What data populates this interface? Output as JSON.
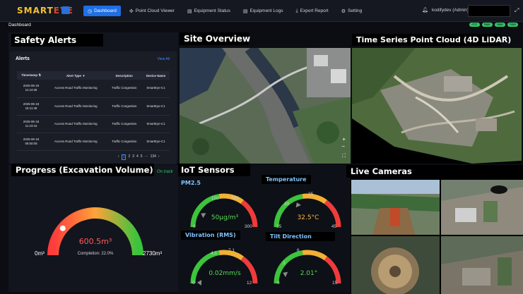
{
  "app": {
    "logo_a": "SMART",
    "logo_b": "EYE"
  },
  "nav": [
    {
      "icon": "◷",
      "label": "Dashboard"
    },
    {
      "icon": "✣",
      "label": "Point Cloud Viewer"
    },
    {
      "icon": "▤",
      "label": "Equipment Status"
    },
    {
      "icon": "▤",
      "label": "Equipment Logs"
    },
    {
      "icon": "⤓",
      "label": "Export Report"
    },
    {
      "icon": "⚙",
      "label": "Setting"
    }
  ],
  "user": {
    "name": "kodifydev (Admin)"
  },
  "breadcrumb": "Dashboard",
  "status_chips": [
    "ATC",
    "N&K",
    "N&K",
    "N&K"
  ],
  "safety": {
    "title": "Safety Alerts",
    "alerts_heading": "Alerts",
    "view_all": "View All",
    "columns": [
      "Timestamp",
      "Alert Type",
      "Description",
      "Device Name"
    ],
    "rows": [
      {
        "date": "2025-06-19",
        "time": "11:24:36",
        "type": "Access Road Traffic Monitoring",
        "desc": "Traffic Congestion",
        "device": "SmartEye-C1"
      },
      {
        "date": "2025-06-18",
        "time": "15:11:49",
        "type": "Access Road Traffic Monitoring",
        "desc": "Traffic Congestion",
        "device": "SmartEye-C1"
      },
      {
        "date": "2025-06-18",
        "time": "11:23:16",
        "type": "Access Road Traffic Monitoring",
        "desc": "Traffic Congestion",
        "device": "SmartEye-C1"
      },
      {
        "date": "2025-06-18",
        "time": "06:50:08",
        "type": "Access Road Traffic Monitoring",
        "desc": "Traffic Congestion",
        "device": "SmartEye-C1"
      }
    ],
    "pages": [
      "1",
      "2",
      "3",
      "4",
      "5",
      "···",
      "134"
    ]
  },
  "site_overview": {
    "title": "Site Overview"
  },
  "point_cloud": {
    "title": "Time Series Point Cloud (4D LiDAR)"
  },
  "progress": {
    "title": "Progress (Excavation Volume)",
    "status": "On track",
    "value": "600.5m³",
    "completion": "Completion: 22.0%",
    "completion_fraction": 0.22,
    "min": "0m³",
    "max": "2730m³"
  },
  "iot": {
    "title": "IoT Sensors",
    "sensors": [
      {
        "name": "PM2.5",
        "value": "50μg/m³",
        "ticks": [
          "0",
          "100",
          "200",
          "300"
        ],
        "fraction": 0.17
      },
      {
        "name": "Temperature",
        "value": "32.5°C",
        "ticks": [
          "25",
          "30",
          "35",
          "45"
        ],
        "fraction": 0.37
      },
      {
        "name": "Vibration (RMS)",
        "value": "0.02mm/s",
        "ticks": [
          "0",
          "4.5",
          "7.1",
          "12"
        ],
        "fraction": 0.01
      },
      {
        "name": "Tilt Direction",
        "value": "2.01°",
        "ticks": [
          "0",
          "3",
          "6",
          "15"
        ],
        "fraction": 0.13
      }
    ]
  },
  "cameras": {
    "title": "Live Cameras"
  },
  "colors": {
    "accent": "#1f6fe5",
    "alert_chip": "#32c86a",
    "value_red": "#ff5c5c",
    "value_green": "#5cd65c",
    "value_orange": "#ffb347"
  }
}
